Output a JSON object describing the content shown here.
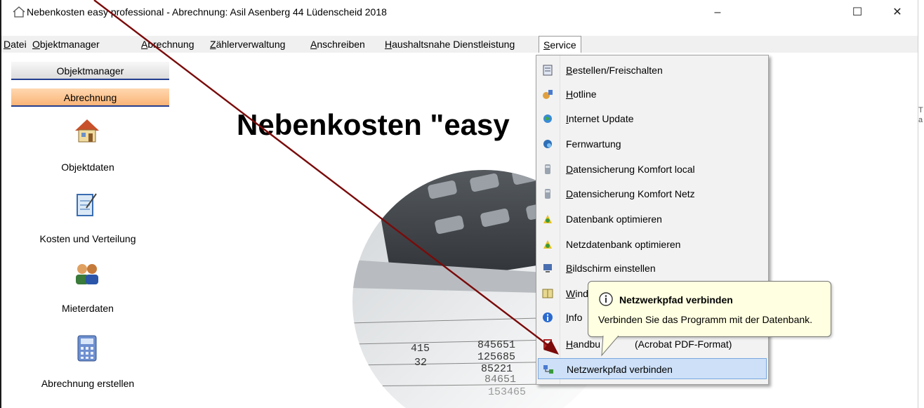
{
  "window": {
    "title": "Nebenkosten easy professional  -  Abrechnung: Asil Asenberg 44 Lüdenscheid 2018",
    "minimize": "–",
    "maximize": "☐",
    "close": "✕"
  },
  "menubar": {
    "items": [
      "Datei",
      "Objektmanager",
      "Abrechnung",
      "Zählerverwaltung",
      "Anschreiben",
      "Haushaltsnahe Dienstleistung",
      "Service"
    ]
  },
  "sidebar": {
    "tabs": [
      "Objektmanager",
      "Abrechnung"
    ],
    "items": [
      {
        "label": "Objektdaten",
        "icon": "house-icon"
      },
      {
        "label": "Kosten und Verteilung",
        "icon": "notepad-icon"
      },
      {
        "label": "Mieterdaten",
        "icon": "people-icon"
      },
      {
        "label": "Abrechnung erstellen",
        "icon": "calculator-icon"
      }
    ]
  },
  "main": {
    "headline": "Nebenkosten \"easy"
  },
  "service_menu": {
    "items": [
      {
        "label": "Bestellen/Freischalten",
        "icon": "order-icon"
      },
      {
        "label": "Hotline",
        "icon": "hotline-icon"
      },
      {
        "label": "Internet Update",
        "icon": "globe-icon"
      },
      {
        "label": "Fernwartung",
        "icon": "remote-icon"
      },
      {
        "label": "Datensicherung Komfort local",
        "icon": "backup-icon"
      },
      {
        "label": "Datensicherung Komfort Netz",
        "icon": "backup-net-icon"
      },
      {
        "label": "Datenbank optimieren",
        "icon": "optimize-icon"
      },
      {
        "label": "Netzdatenbank optimieren",
        "icon": "net-optimize-icon"
      },
      {
        "label": "Bildschirm einstellen",
        "icon": "screen-icon"
      },
      {
        "label": "Wind",
        "icon": "window-icon"
      },
      {
        "label": "Info",
        "icon": "info-icon"
      },
      {
        "label": "Handbu",
        "label_suffix": "(Acrobat PDF-Format)",
        "icon": "manual-icon"
      },
      {
        "label": "Netzwerkpfad verbinden",
        "icon": "network-path-icon"
      }
    ],
    "highlighted_index": 12
  },
  "tooltip": {
    "title": "Netzwerkpfad verbinden",
    "text": "Verbinden Sie das Programm mit der Datenbank."
  },
  "colors": {
    "annotation_arrow": "#7b0a0a",
    "tab_active": "#f9b477",
    "menu_highlight": "#cde0f7",
    "tooltip_bg": "#ffffe1"
  }
}
